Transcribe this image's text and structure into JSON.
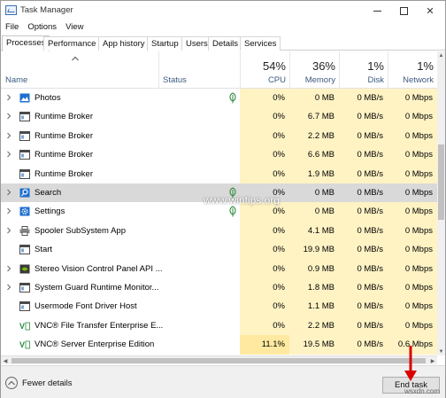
{
  "window": {
    "title": "Task Manager"
  },
  "menu": {
    "items": [
      "File",
      "Options",
      "View"
    ]
  },
  "tabs": [
    "Processes",
    "Performance",
    "App history",
    "Startup",
    "Users",
    "Details",
    "Services"
  ],
  "header": {
    "name": "Name",
    "status": "Status",
    "cpu_pct": "54%",
    "cpu_label": "CPU",
    "memory_pct": "36%",
    "memory_label": "Memory",
    "disk_pct": "1%",
    "disk_label": "Disk",
    "network_pct": "1%",
    "network_label": "Network"
  },
  "processes": [
    {
      "name": "Photos",
      "icon": "photos-icon",
      "expand": true,
      "leaf": true,
      "cpu": "0%",
      "memory": "0 MB",
      "disk": "0 MB/s",
      "network": "0 Mbps"
    },
    {
      "name": "Runtime Broker",
      "icon": "app-window-icon",
      "expand": true,
      "leaf": false,
      "cpu": "0%",
      "memory": "6.7 MB",
      "disk": "0 MB/s",
      "network": "0 Mbps"
    },
    {
      "name": "Runtime Broker",
      "icon": "app-window-icon",
      "expand": true,
      "leaf": false,
      "cpu": "0%",
      "memory": "2.2 MB",
      "disk": "0 MB/s",
      "network": "0 Mbps"
    },
    {
      "name": "Runtime Broker",
      "icon": "app-window-icon",
      "expand": true,
      "leaf": false,
      "cpu": "0%",
      "memory": "6.6 MB",
      "disk": "0 MB/s",
      "network": "0 Mbps"
    },
    {
      "name": "Runtime Broker",
      "icon": "app-window-icon",
      "expand": false,
      "leaf": false,
      "cpu": "0%",
      "memory": "1.9 MB",
      "disk": "0 MB/s",
      "network": "0 Mbps"
    },
    {
      "name": "Search",
      "icon": "search-app-icon",
      "expand": true,
      "leaf": true,
      "selected": true,
      "cpu": "0%",
      "memory": "0 MB",
      "disk": "0 MB/s",
      "network": "0 Mbps"
    },
    {
      "name": "Settings",
      "icon": "settings-gear-icon",
      "expand": true,
      "leaf": true,
      "cpu": "0%",
      "memory": "0 MB",
      "disk": "0 MB/s",
      "network": "0 Mbps"
    },
    {
      "name": "Spooler SubSystem App",
      "icon": "printer-icon",
      "expand": true,
      "leaf": false,
      "cpu": "0%",
      "memory": "4.1 MB",
      "disk": "0 MB/s",
      "network": "0 Mbps"
    },
    {
      "name": "Start",
      "icon": "app-window-icon",
      "expand": false,
      "leaf": false,
      "cpu": "0%",
      "memory": "19.9 MB",
      "disk": "0 MB/s",
      "network": "0 Mbps"
    },
    {
      "name": "Stereo Vision Control Panel API ...",
      "icon": "nvidia-icon",
      "expand": true,
      "leaf": false,
      "cpu": "0%",
      "memory": "0.9 MB",
      "disk": "0 MB/s",
      "network": "0 Mbps"
    },
    {
      "name": "System Guard Runtime Monitor...",
      "icon": "app-window-icon",
      "expand": true,
      "leaf": false,
      "cpu": "0%",
      "memory": "1.8 MB",
      "disk": "0 MB/s",
      "network": "0 Mbps"
    },
    {
      "name": "Usermode Font Driver Host",
      "icon": "app-window-icon",
      "expand": false,
      "leaf": false,
      "cpu": "0%",
      "memory": "1.1 MB",
      "disk": "0 MB/s",
      "network": "0 Mbps"
    },
    {
      "name": "VNC® File Transfer Enterprise E...",
      "icon": "vnc-icon",
      "expand": false,
      "leaf": false,
      "cpu": "0%",
      "memory": "2.2 MB",
      "disk": "0 MB/s",
      "network": "0 Mbps"
    },
    {
      "name": "VNC® Server Enterprise Edition",
      "icon": "vnc-icon",
      "expand": false,
      "leaf": false,
      "hot": true,
      "cpu": "11.1%",
      "memory": "19.5 MB",
      "disk": "0 MB/s",
      "network": "0.6 Mbps"
    }
  ],
  "watermark": "www.wintips.org",
  "footer": {
    "fewer_details": "Fewer details",
    "end_task": "End task"
  },
  "brand": "wsxdn.com"
}
